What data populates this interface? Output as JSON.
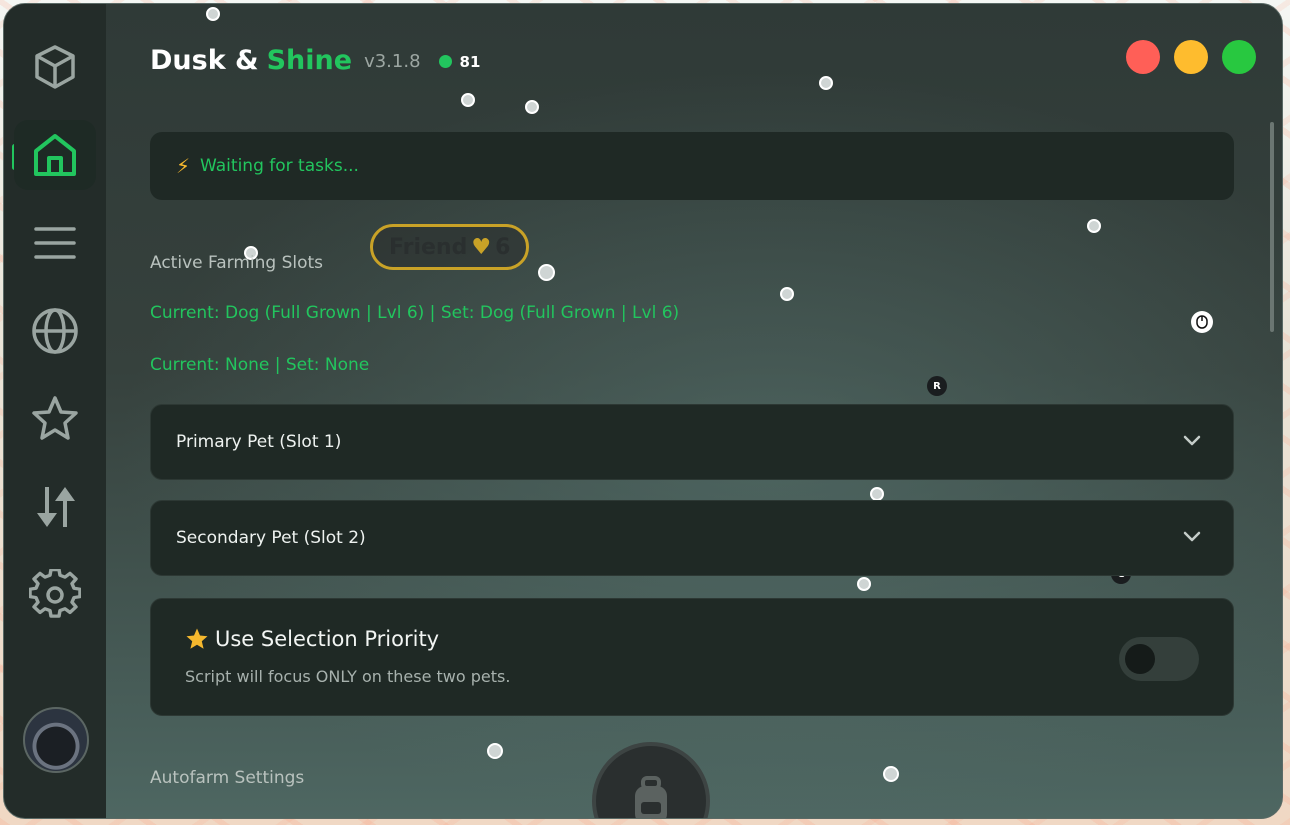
{
  "app": {
    "title_part1": "Dusk &",
    "title_part2": "Shine",
    "version": "v3.1.8",
    "online_count": "81"
  },
  "window_controls": {
    "close_color": "#ff5f57",
    "minimize_color": "#febc2e",
    "maximize_color": "#28c840"
  },
  "sidebar": {
    "items": [
      {
        "icon": "cube-icon",
        "active": false
      },
      {
        "icon": "home-icon",
        "active": true
      },
      {
        "icon": "menu-icon",
        "active": false
      },
      {
        "icon": "globe-icon",
        "active": false
      },
      {
        "icon": "star-icon",
        "active": false
      },
      {
        "icon": "transfer-icon",
        "active": false
      },
      {
        "icon": "gear-icon",
        "active": false
      }
    ]
  },
  "status": {
    "icon": "lightning-icon",
    "text": "Waiting for tasks..."
  },
  "slots": {
    "section_label": "Active Farming Slots",
    "line1": "Current: Dog (Full Grown | Lvl 6) | Set: Dog (Full Grown | Lvl 6)",
    "line2": "Current: None | Set: None"
  },
  "dropdowns": {
    "primary_label": "Primary Pet (Slot 1)",
    "secondary_label": "Secondary Pet (Slot 2)"
  },
  "priority": {
    "icon": "star-icon",
    "title": "Use Selection Priority",
    "subtitle": "Script will focus ONLY on these two pets.",
    "enabled": false
  },
  "settings": {
    "section_label": "Autofarm Settings"
  },
  "game_overlay": {
    "friend_tag": "Friend",
    "friend_count": "6",
    "key_r": "R",
    "key_c": "C"
  },
  "colors": {
    "accent": "#22c55e",
    "card": "#1f2925",
    "sidebar": "#232c29"
  }
}
